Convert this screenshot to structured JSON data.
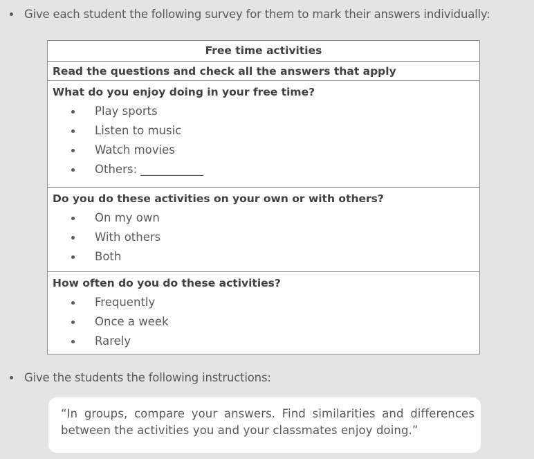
{
  "intro": "Give each student the following survey for them to mark their answers individually:",
  "survey": {
    "title": "Free time activities",
    "instructions": "Read the questions and check all the answers that apply",
    "questions": [
      {
        "question": "What do you enjoy doing in your free time?",
        "options": [
          "Play sports",
          "Listen to music",
          "Watch movies",
          "Others: ___________"
        ]
      },
      {
        "question": "Do you do these activities on your own or with others?",
        "options": [
          "On my own",
          "With others",
          "Both"
        ]
      },
      {
        "question": "How often do you do these activities?",
        "options": [
          "Frequently",
          "Once a week",
          "Rarely"
        ]
      }
    ]
  },
  "instruction_line": "Give the students the following instructions:",
  "quote": "“In groups, compare your answers. Find similarities and differences between the activities you and your classmates enjoy doing.”"
}
